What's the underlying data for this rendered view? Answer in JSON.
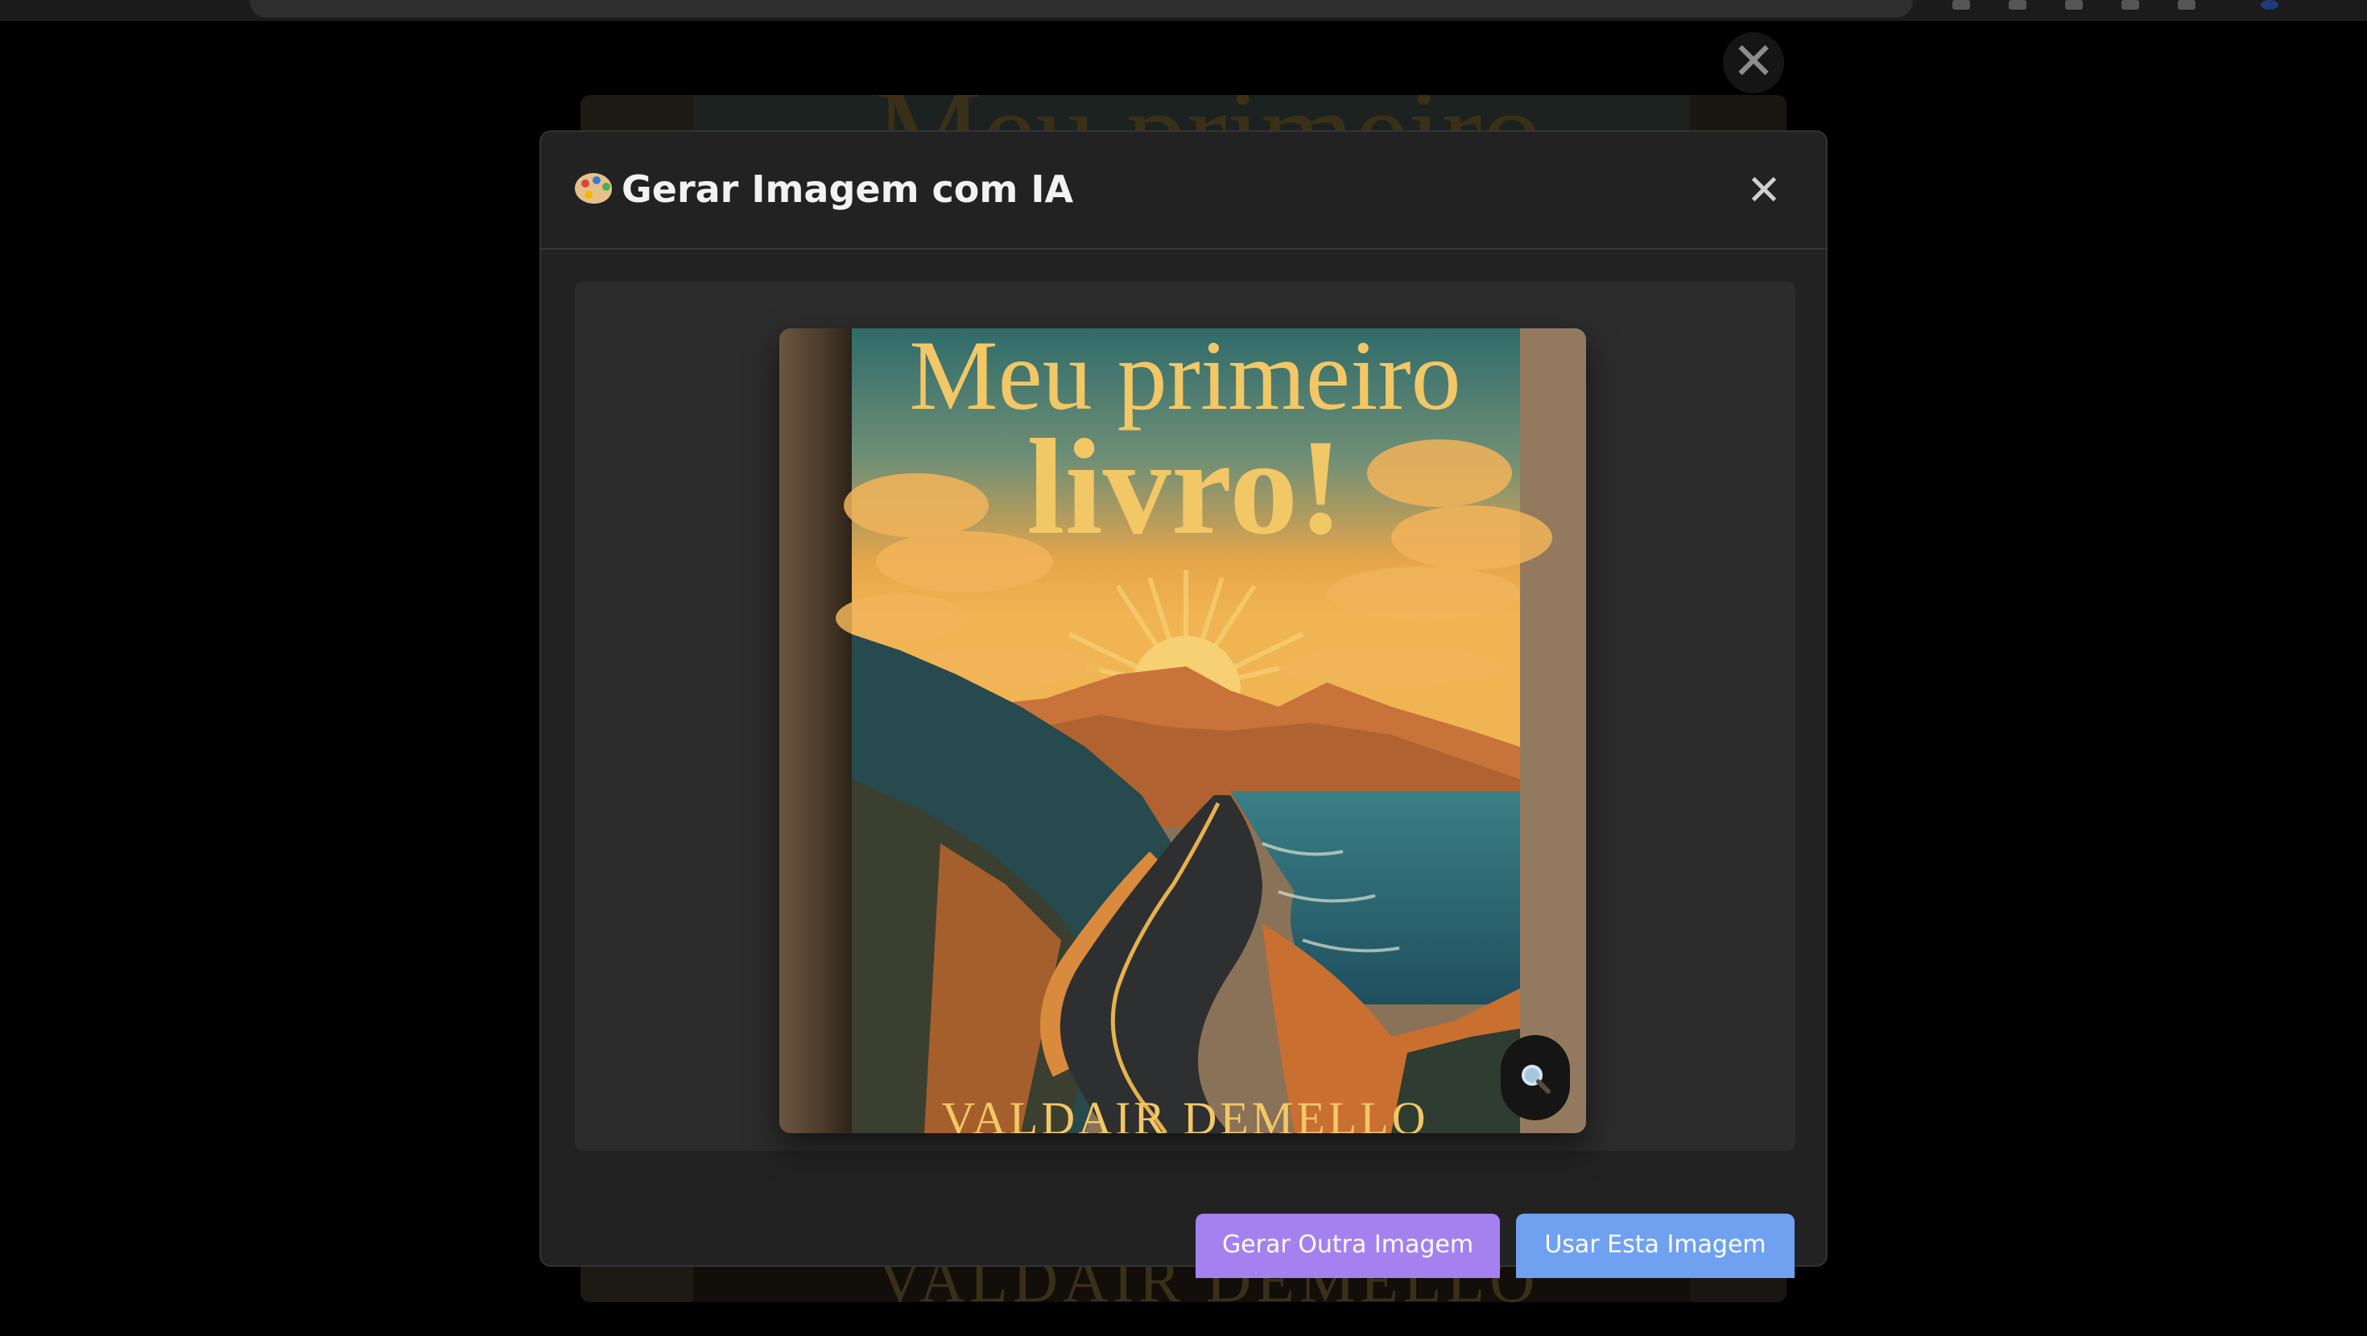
{
  "modal": {
    "title": "Gerar Imagem com IA",
    "title_icon": "palette-icon",
    "close_label": "✕"
  },
  "viewer": {
    "close_label": "✕"
  },
  "generated_image": {
    "cover_title_line1": "Meu primeiro",
    "cover_title_line2": "livro!",
    "cover_author": "VALDAIR DEMELLO",
    "zoom_icon": "magnifier-icon"
  },
  "background_cover": {
    "title": "Meu primeiro",
    "author": "VALDAIR DEMELLO"
  },
  "actions": {
    "generate_another": "Gerar Outra Imagem",
    "use_this": "Usar Esta Imagem"
  },
  "colors": {
    "accent_purple": "#a481ee",
    "accent_blue": "#6fa1f0",
    "modal_bg": "#222222",
    "cover_gold": "#f2c766"
  }
}
